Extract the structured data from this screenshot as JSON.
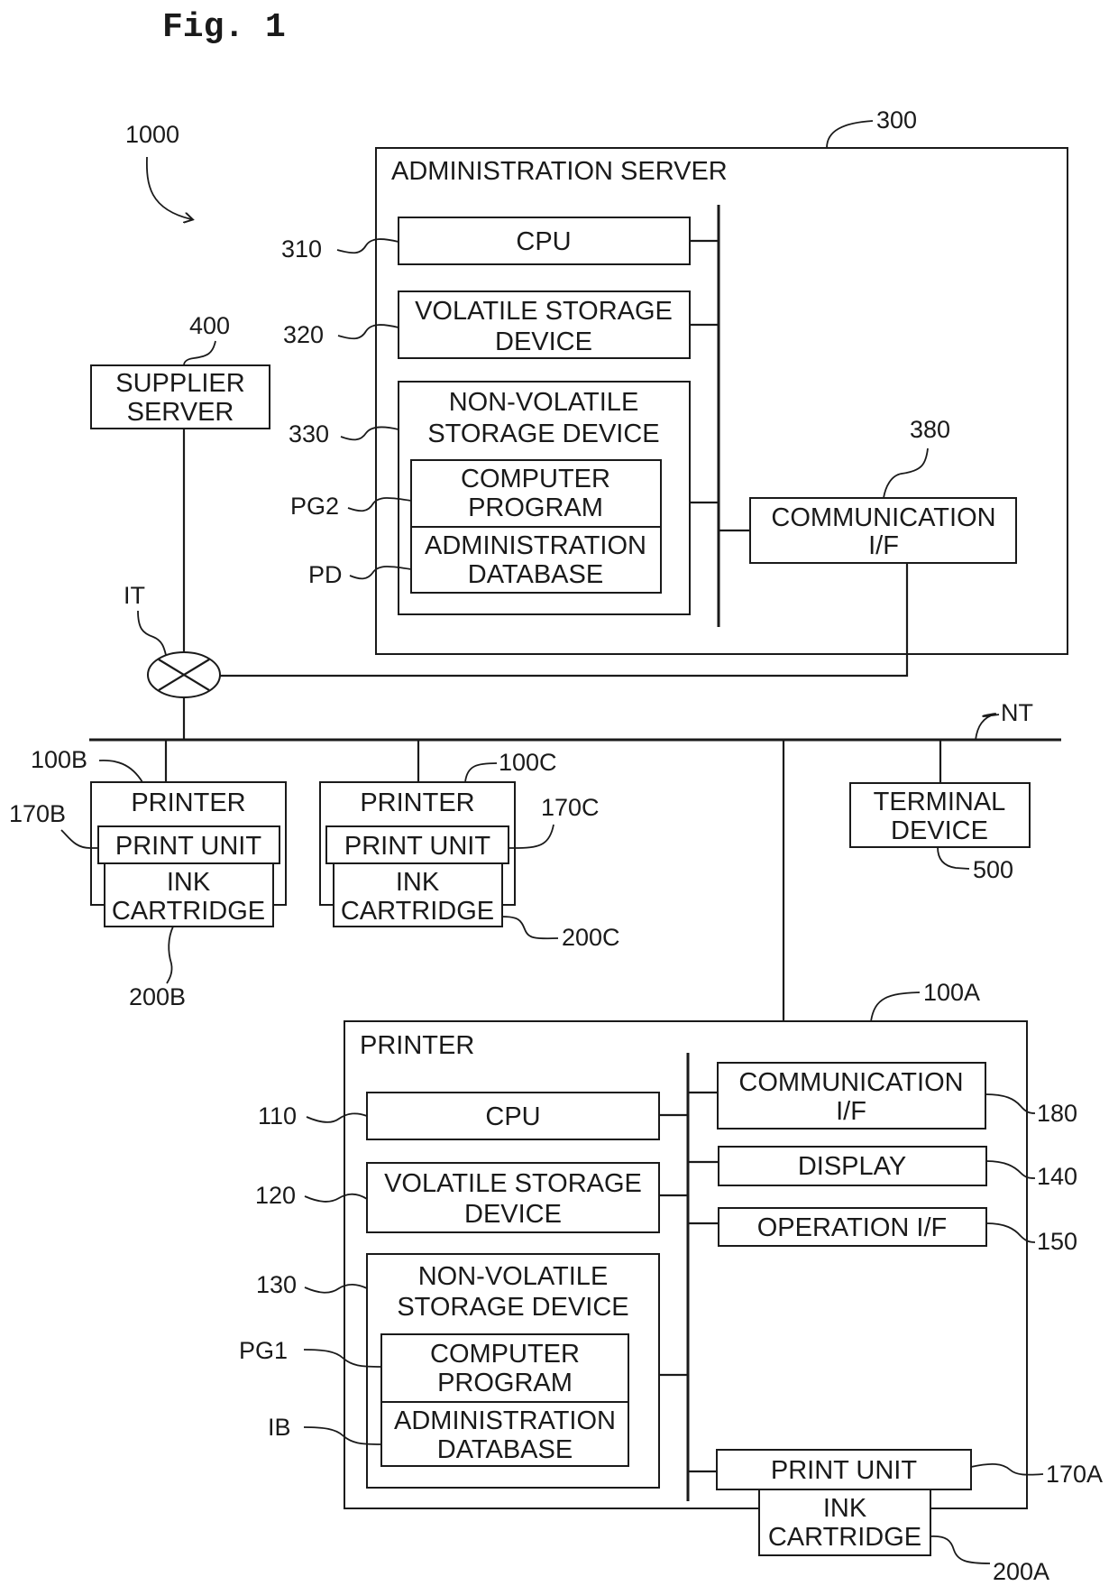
{
  "figure": {
    "title": "Fig. 1",
    "system_ref": "1000"
  },
  "admin_server": {
    "ref": "300",
    "title": "ADMINISTRATION SERVER",
    "cpu": {
      "ref": "310",
      "label": "CPU"
    },
    "volatile": {
      "ref": "320",
      "line1": "VOLATILE STORAGE",
      "line2": "DEVICE"
    },
    "nonvolatile": {
      "ref": "330",
      "line1": "NON-VOLATILE",
      "line2": "STORAGE DEVICE"
    },
    "program": {
      "ref": "PG2",
      "line1": "COMPUTER",
      "line2": "PROGRAM"
    },
    "database": {
      "ref": "PD",
      "line1": "ADMINISTRATION",
      "line2": "DATABASE"
    },
    "comm": {
      "ref": "380",
      "line1": "COMMUNICATION",
      "line2": "I/F"
    }
  },
  "supplier_server": {
    "ref": "400",
    "line1": "SUPPLIER",
    "line2": "SERVER"
  },
  "internet": {
    "ref": "IT"
  },
  "network": {
    "ref": "NT"
  },
  "printer_b": {
    "ref": "100B",
    "title": "PRINTER",
    "print_unit": {
      "ref": "170B",
      "label": "PRINT UNIT"
    },
    "ink": {
      "ref": "200B",
      "line1": "INK",
      "line2": "CARTRIDGE"
    }
  },
  "printer_c": {
    "ref": "100C",
    "title": "PRINTER",
    "print_unit": {
      "ref": "170C",
      "label": "PRINT UNIT"
    },
    "ink": {
      "ref": "200C",
      "line1": "INK",
      "line2": "CARTRIDGE"
    }
  },
  "terminal": {
    "ref": "500",
    "line1": "TERMINAL",
    "line2": "DEVICE"
  },
  "printer_a": {
    "ref": "100A",
    "title": "PRINTER",
    "cpu": {
      "ref": "110",
      "label": "CPU"
    },
    "volatile": {
      "ref": "120",
      "line1": "VOLATILE STORAGE",
      "line2": "DEVICE"
    },
    "nonvolatile": {
      "ref": "130",
      "line1": "NON-VOLATILE",
      "line2": "STORAGE DEVICE"
    },
    "program": {
      "ref": "PG1",
      "line1": "COMPUTER",
      "line2": "PROGRAM"
    },
    "database": {
      "ref": "IB",
      "line1": "ADMINISTRATION",
      "line2": "DATABASE"
    },
    "comm": {
      "ref": "180",
      "line1": "COMMUNICATION",
      "line2": "I/F"
    },
    "display": {
      "ref": "140",
      "label": "DISPLAY"
    },
    "operation": {
      "ref": "150",
      "label": "OPERATION I/F"
    },
    "print_unit": {
      "ref": "170A",
      "label": "PRINT UNIT"
    },
    "ink": {
      "ref": "200A",
      "line1": "INK",
      "line2": "CARTRIDGE"
    }
  }
}
